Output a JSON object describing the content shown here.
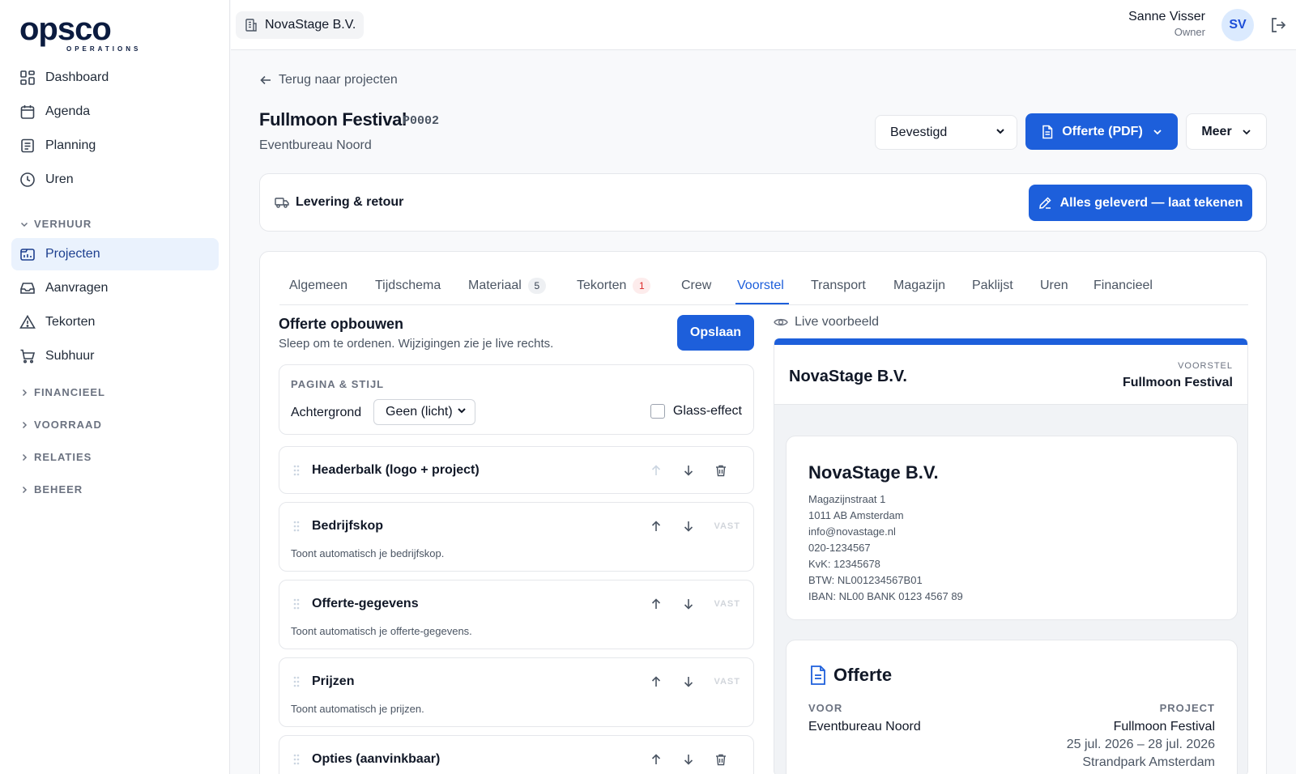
{
  "brand": {
    "name": "opsco",
    "tagline": "OPERATIONS"
  },
  "sidebar": {
    "items": [
      {
        "label": "Dashboard",
        "icon": "dashboard-icon"
      },
      {
        "label": "Agenda",
        "icon": "calendar-icon"
      },
      {
        "label": "Planning",
        "icon": "planning-icon"
      },
      {
        "label": "Uren",
        "icon": "clock-icon"
      }
    ],
    "groups": {
      "verhuur": "VERHUUR",
      "financieel": "FINANCIEEL",
      "voorraad": "VOORRAAD",
      "relaties": "RELATIES",
      "beheer": "BEHEER"
    },
    "verhuur_items": [
      {
        "label": "Projecten",
        "icon": "projects-icon",
        "active": true
      },
      {
        "label": "Aanvragen",
        "icon": "inbox-icon"
      },
      {
        "label": "Tekorten",
        "icon": "warning-icon"
      },
      {
        "label": "Subhuur",
        "icon": "cart-icon"
      }
    ]
  },
  "topbar": {
    "org": "NovaStage B.V.",
    "user_name": "Sanne Visser",
    "user_role": "Owner",
    "avatar_initials": "SV"
  },
  "project": {
    "back": "Terug naar projecten",
    "title": "Fullmoon Festival",
    "code": "P0002",
    "client": "Eventbureau Noord",
    "status": "Bevestigd",
    "pdf_button": "Offerte (PDF)",
    "more_button": "Meer"
  },
  "delivery": {
    "label": "Levering & retour",
    "button": "Alles geleverd — laat tekenen"
  },
  "tabs": [
    {
      "label": "Algemeen"
    },
    {
      "label": "Tijdschema"
    },
    {
      "label": "Materiaal",
      "badge": "5"
    },
    {
      "label": "Tekorten",
      "badge": "1"
    },
    {
      "label": "Crew"
    },
    {
      "label": "Voorstel",
      "active": true
    },
    {
      "label": "Transport"
    },
    {
      "label": "Magazijn"
    },
    {
      "label": "Paklijst"
    },
    {
      "label": "Uren"
    },
    {
      "label": "Financieel"
    }
  ],
  "builder": {
    "title": "Offerte opbouwen",
    "subtitle": "Sleep om te ordenen. Wijzigingen zie je live rechts.",
    "save": "Opslaan",
    "page_style_label": "PAGINA & STIJL",
    "background_label": "Achtergrond",
    "background_value": "Geen (licht)",
    "glass_label": "Glass-effect",
    "glass_checked": false,
    "fixed_label": "VAST",
    "blocks": [
      {
        "name": "Headerbalk (logo + project)",
        "desc": ""
      },
      {
        "name": "Bedrijfskop",
        "desc": "Toont automatisch je bedrijfskop."
      },
      {
        "name": "Offerte-gegevens",
        "desc": "Toont automatisch je offerte-gegevens."
      },
      {
        "name": "Prijzen",
        "desc": "Toont automatisch je prijzen."
      },
      {
        "name": "Opties (aanvinkbaar)",
        "desc": ""
      }
    ]
  },
  "preview": {
    "label": "Live voorbeeld",
    "header_company": "NovaStage B.V.",
    "header_kind": "VOORSTEL",
    "header_project": "Fullmoon Festival",
    "company": {
      "name": "NovaStage B.V.",
      "lines": [
        "Magazijnstraat 1",
        "1011 AB Amsterdam",
        "info@novastage.nl",
        "020-1234567",
        "KvK: 12345678",
        "BTW: NL001234567B01",
        "IBAN: NL00 BANK 0123 4567 89"
      ]
    },
    "offer": {
      "title": "Offerte",
      "for_label": "VOOR",
      "for_value": "Eventbureau Noord",
      "project_label": "PROJECT",
      "project_value": "Fullmoon Festival",
      "dates": "25 jul. 2026 – 28 jul. 2026",
      "location": "Strandpark Amsterdam"
    }
  },
  "colors": {
    "accent": "#1d5fdb",
    "active_nav_bg": "#eaf2fd"
  }
}
